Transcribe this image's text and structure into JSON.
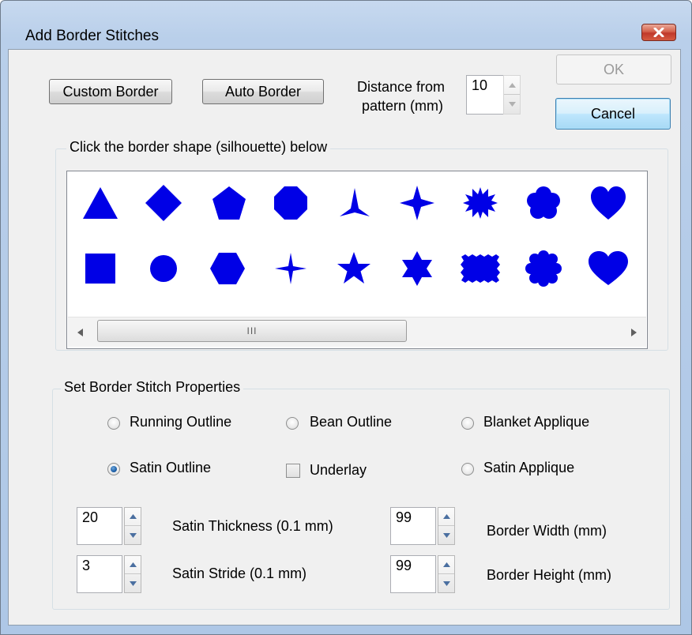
{
  "window": {
    "title": "Add Border Stitches"
  },
  "toolbar": {
    "custom_border": "Custom Border",
    "auto_border": "Auto Border",
    "distance_label_1": "Distance from",
    "distance_label_2": "pattern (mm)",
    "distance_value": "10",
    "ok": "OK",
    "cancel": "Cancel"
  },
  "shapes_group": {
    "title": "Click the border shape (silhouette) below",
    "scroll_thumb_grip": "III",
    "row1": [
      "triangle",
      "diamond",
      "pentagon",
      "octagon",
      "three-point-star",
      "four-point-star",
      "starburst",
      "flower",
      "heart"
    ],
    "row2": [
      "square",
      "circle",
      "hexagon",
      "thin-four-point-star",
      "five-point-star",
      "six-point-star",
      "wavy-rectangle",
      "rosette",
      "heart-large"
    ],
    "shape_color": "#0000e6"
  },
  "props_group": {
    "title": "Set Border Stitch Properties",
    "running_outline": "Running Outline",
    "bean_outline": "Bean Outline",
    "blanket_applique": "Blanket Applique",
    "satin_outline": "Satin Outline",
    "underlay": "Underlay",
    "satin_applique": "Satin Applique",
    "selected_stitch": "Satin Outline",
    "underlay_checked": false,
    "satin_thickness_value": "20",
    "satin_thickness_label": "Satin Thickness (0.1 mm)",
    "satin_stride_value": "3",
    "satin_stride_label": "Satin Stride (0.1 mm)",
    "border_width_value": "99",
    "border_width_label": "Border Width (mm)",
    "border_height_value": "99",
    "border_height_label": "Border Height (mm)"
  }
}
